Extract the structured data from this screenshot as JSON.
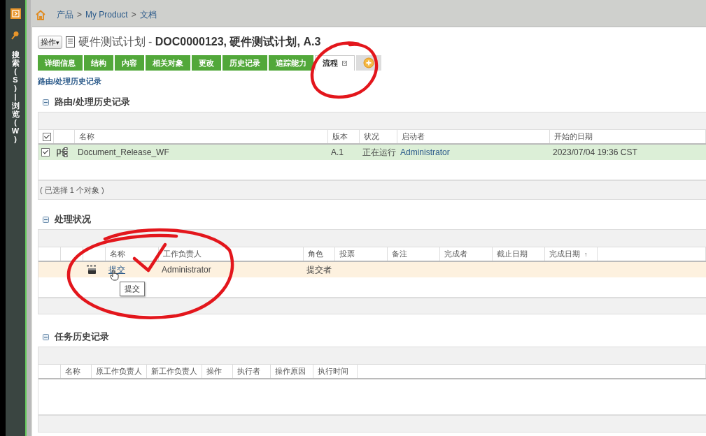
{
  "sidebar": {
    "label": "搜索(S) | 浏览(W)"
  },
  "breadcrumb": [
    "产品",
    "My Product",
    "文档"
  ],
  "breadcrumb_separator": ">",
  "header": {
    "actions_button": "操作",
    "actions_caret": "▾",
    "title": "硬件测试计划 - **DOC0000123, 硬件测试计划, A.3**"
  },
  "tabs": [
    {
      "label": "详细信息",
      "selected": false
    },
    {
      "label": "结构",
      "selected": false
    },
    {
      "label": "内容",
      "selected": false
    },
    {
      "label": "相关对象",
      "selected": false
    },
    {
      "label": "更改",
      "selected": false
    },
    {
      "label": "历史记录",
      "selected": false
    },
    {
      "label": "追踪能力",
      "selected": false
    },
    {
      "label": "流程",
      "selected": true
    }
  ],
  "page_link": "路由/处理历史记录",
  "sections": [
    {
      "title": "路由/处理历史记录",
      "columns": [
        {
          "kind": "checkbox",
          "checked": true
        },
        {
          "kind": "blank"
        },
        {
          "kind": "text",
          "label": "名称"
        },
        {
          "kind": "text",
          "label": "版本"
        },
        {
          "kind": "text",
          "label": "状况"
        },
        {
          "kind": "text",
          "label": "启动者"
        },
        {
          "kind": "text",
          "label": "开始的日期"
        }
      ],
      "rows": [
        {
          "selected": true,
          "cells": [
            {
              "kind": "checkbox",
              "checked": true
            },
            {
              "kind": "process_icon"
            },
            {
              "kind": "text",
              "text": "Document_Release_WF"
            },
            {
              "kind": "text",
              "text": "A.1"
            },
            {
              "kind": "text",
              "text": "正在运行"
            },
            {
              "kind": "link",
              "text": "Administrator"
            },
            {
              "kind": "text",
              "text": "2023/07/04 19:36 CST"
            }
          ]
        }
      ],
      "footer": "( 已选择 1 个对象 )"
    },
    {
      "title": "处理状况",
      "columns": [
        {
          "kind": "blank"
        },
        {
          "kind": "blank"
        },
        {
          "kind": "blank"
        },
        {
          "kind": "text",
          "label": "名称"
        },
        {
          "kind": "text",
          "label": "工作负责人"
        },
        {
          "kind": "text",
          "label": "角色"
        },
        {
          "kind": "text",
          "label": "投票"
        },
        {
          "kind": "text",
          "label": "备注"
        },
        {
          "kind": "text",
          "label": "完成者"
        },
        {
          "kind": "text",
          "label": "截止日期"
        },
        {
          "kind": "text",
          "label": "完成日期",
          "sort_mark": "↑"
        },
        {
          "kind": "blank"
        }
      ],
      "rows": [
        {
          "selected": true,
          "cells": [
            {
              "kind": "blank"
            },
            {
              "kind": "blank"
            },
            {
              "kind": "task_icon"
            },
            {
              "kind": "link",
              "text": "提交"
            },
            {
              "kind": "text",
              "text": "Administrator"
            },
            {
              "kind": "text",
              "text": "提交者"
            }
          ]
        }
      ],
      "tooltip": "提交"
    },
    {
      "title": "任务历史记录",
      "columns": [
        {
          "kind": "blank"
        },
        {
          "kind": "text",
          "label": "名称"
        },
        {
          "kind": "text",
          "label": "原工作负责人"
        },
        {
          "kind": "text",
          "label": "新工作负责人"
        },
        {
          "kind": "text",
          "label": "操作"
        },
        {
          "kind": "text",
          "label": "执行者"
        },
        {
          "kind": "text",
          "label": "操作原因"
        },
        {
          "kind": "text",
          "label": "执行时间"
        },
        {
          "kind": "blank"
        }
      ]
    }
  ]
}
